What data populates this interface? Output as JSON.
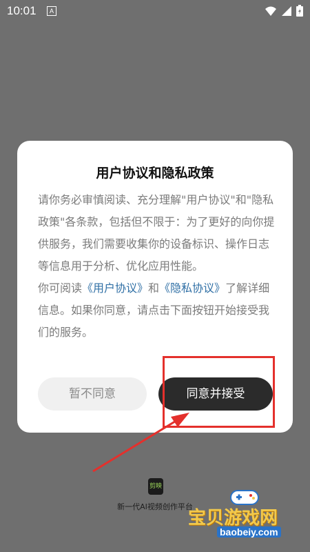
{
  "status_bar": {
    "time": "10:01",
    "notification_badge": "A",
    "icons": [
      "wifi-icon",
      "signal-icon",
      "battery-icon"
    ]
  },
  "dialog": {
    "title": "用户协议和隐私政策",
    "body_intro": "请你务必审慎阅读、充分理解\"用户协议\"和\"隐私政策\"各条款，包括但不限于：为了更好的向你提供服务，我们需要收集你的设备标识、操作日志等信息用于分析、优化应用性能。",
    "body_read_prefix": "你可阅读",
    "user_agreement_link": "《用户协议》",
    "body_and": "和",
    "privacy_link": "《隐私协议》",
    "body_read_suffix": "了解详细信息。如果你同意，请点击下面按钮开始接受我们的服务。",
    "decline_label": "暂不同意",
    "accept_label": "同意并接受"
  },
  "footer": {
    "logo_text": "剪映",
    "tagline": "新一代AI视频创作平台"
  },
  "watermark": {
    "title": "宝贝游戏网",
    "url": "baobeiy.com"
  },
  "colors": {
    "overlay": "#6f6f6f",
    "accept_button": "#2b2b2b",
    "link": "#2f6fa5",
    "annotation": "#e4302c"
  }
}
